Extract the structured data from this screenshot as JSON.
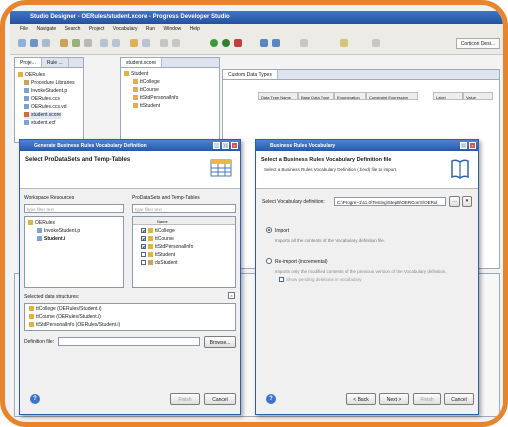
{
  "ide": {
    "title": "Studio Designer - OERules/student.xcore - Progress Developer Studio",
    "menu": [
      "File",
      "Navigate",
      "Search",
      "Project",
      "Vocabulary",
      "Run",
      "Window",
      "Help"
    ],
    "perspective": "Corticon Desi...",
    "explorer_tabs": [
      "Proje...",
      "Rule ..."
    ],
    "tree": [
      "OERules",
      "Procedure Libraries",
      "InvokeStudent.p",
      "OERules.ccs",
      "OERules.ccs.vd",
      "student.xcore",
      "student.ecf"
    ],
    "editor_tab": "student.xcore",
    "vocab_tree": [
      "Student",
      "ttCollege",
      "ttCourse",
      "ttStdPersonalInfo",
      "ttStudent"
    ],
    "custom_tab": "Custom Data Types",
    "grid_cols": [
      "Data Type Name",
      "Base Data Type",
      "Enumeration",
      "Constraint Expression"
    ],
    "grid_cols_right": [
      "Label",
      "Value"
    ]
  },
  "left_dialog": {
    "title": "Generate Business Rules Vocabulary Definition",
    "heading": "Select ProDataSets and Temp-Tables",
    "workspace_label": "Workspace Resources",
    "prodatasets_label": "ProDataSets and Temp-Tables",
    "filter_placeholder": "type filter text",
    "ws_tree": [
      "OERules",
      "InvokeStudent.p",
      "Student.i"
    ],
    "col_name": "Name",
    "tables": [
      "ttCollege",
      "ttCourse",
      "ttStdPersonalInfo",
      "ttStudent",
      "dsStudent"
    ],
    "selected_label": "Selected data structures:",
    "selected": [
      "ttCollege (OERules/Student.i)",
      "ttCourse (OERules/Student.i)",
      "ttStdPersonalInfo (OERules/Student.i)"
    ],
    "def_file_label": "Definition file:",
    "browse": "Browse...",
    "finish": "Finish",
    "cancel": "Cancel",
    "help": "?"
  },
  "right_dialog": {
    "title": "Business Rules Vocabulary",
    "heading": "Select a Business Rules Vocabulary Definition file",
    "desc": "Select a Business Rules Vocabulary Definition (.brvd) file to import.",
    "file_label": "Select Vocabulary definition:",
    "file_value": "C:\\Progre~1\\11.0\\Testing\\StepB\\OERCorrS\\OERul",
    "import_label": "Import",
    "import_desc": "Imports all the contents of the Vocabulary definition file.",
    "reimport_label": "Re-import (incremental)",
    "reimport_desc": "Imports only the modified contents of the previous version of the Vocabulary definition.",
    "reimport_sub": "Show pending deletions in vocabulary",
    "back": "< Back",
    "next": "Next >",
    "finish": "Finish",
    "cancel": "Cancel",
    "help": "?"
  },
  "colors": {
    "frame": "#e8852c",
    "titlebar": "#2a5aab",
    "folder": "#e3b23c"
  }
}
